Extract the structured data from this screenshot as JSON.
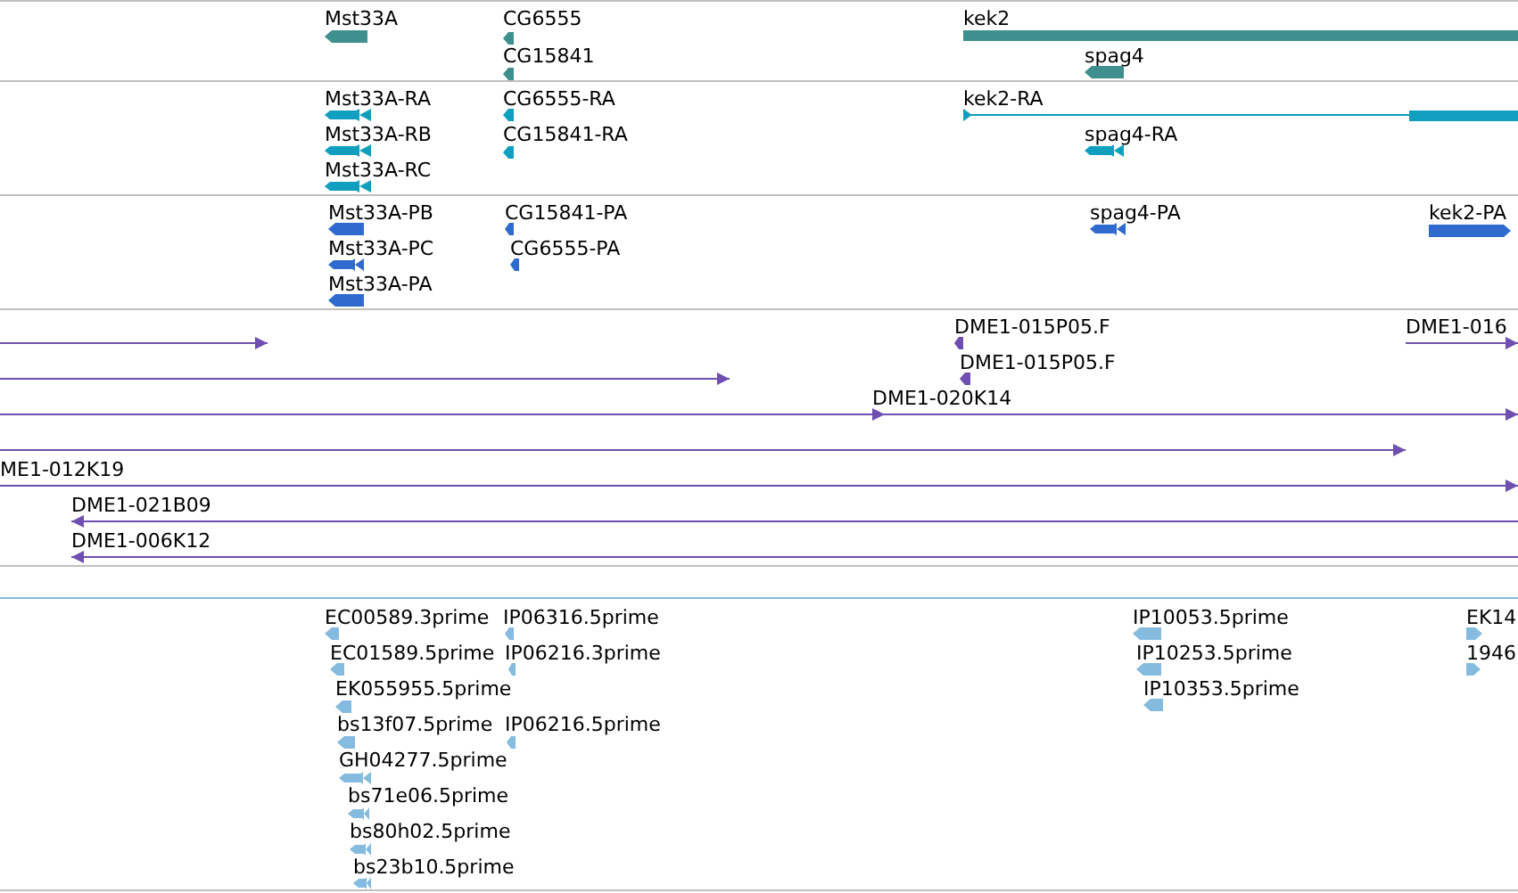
{
  "tracks": [
    {
      "color": "#3f8f8f",
      "selected": false,
      "features": [
        {
          "label": "Mst33A",
          "kind": "block",
          "reverse": true
        },
        {
          "label": "CG6555",
          "kind": "block",
          "reverse": true
        },
        {
          "label": "CG15841",
          "kind": "block",
          "reverse": true
        },
        {
          "label": "kek2",
          "kind": "bar"
        },
        {
          "label": "spag4",
          "kind": "block",
          "reverse": true
        }
      ]
    },
    {
      "color": "#109fbf",
      "selected": false,
      "features": [
        {
          "label": "Mst33A-RA",
          "kind": "exons",
          "reverse": true
        },
        {
          "label": "Mst33A-RB",
          "kind": "exons",
          "reverse": true
        },
        {
          "label": "Mst33A-RC",
          "kind": "exons",
          "reverse": true
        },
        {
          "label": "CG6555-RA",
          "kind": "block",
          "reverse": true
        },
        {
          "label": "CG15841-RA",
          "kind": "block",
          "reverse": true
        },
        {
          "label": "kek2-RA",
          "kind": "transcript",
          "reverse": false
        },
        {
          "label": "spag4-RA",
          "kind": "exons",
          "reverse": true
        }
      ]
    },
    {
      "color": "#2f6bcf",
      "selected": false,
      "features": [
        {
          "label": "Mst33A-PB",
          "kind": "block",
          "reverse": true
        },
        {
          "label": "Mst33A-PC",
          "kind": "exons",
          "reverse": true
        },
        {
          "label": "Mst33A-PA",
          "kind": "block",
          "reverse": true
        },
        {
          "label": "CG15841-PA",
          "kind": "block",
          "reverse": true
        },
        {
          "label": "CG6555-PA",
          "kind": "block",
          "reverse": true
        },
        {
          "label": "spag4-PA",
          "kind": "exons",
          "reverse": true
        },
        {
          "label": "kek2-PA",
          "kind": "block",
          "reverse": false
        }
      ]
    },
    {
      "color": "#6f4fb0",
      "selected": false,
      "features": [
        {
          "kind": "line",
          "reverse": false
        },
        {
          "label": "DME1-015P05.F",
          "kind": "block",
          "reverse": true
        },
        {
          "label": "DME1-016",
          "kind": "line",
          "reverse": false
        },
        {
          "kind": "line",
          "reverse": false
        },
        {
          "label": "DME1-015P05.F",
          "kind": "block",
          "reverse": true
        },
        {
          "kind": "line",
          "reverse": false
        },
        {
          "label": "DME1-020K14",
          "kind": "line",
          "reverse": false
        },
        {
          "kind": "line",
          "reverse": false
        },
        {
          "label": "ME1-012K19",
          "kind": "line",
          "reverse": false
        },
        {
          "label": "DME1-021B09",
          "kind": "line",
          "reverse": true
        },
        {
          "label": "DME1-006K12",
          "kind": "line",
          "reverse": true
        }
      ]
    },
    {
      "color": "#85bbdf",
      "selected": true,
      "features": [
        {
          "label": "EC00589.3prime",
          "kind": "block",
          "reverse": true
        },
        {
          "label": "EC01589.5prime",
          "kind": "block",
          "reverse": true
        },
        {
          "label": "EK055955.5prime",
          "kind": "block",
          "reverse": true
        },
        {
          "label": "bs13f07.5prime",
          "kind": "block",
          "reverse": true
        },
        {
          "label": "GH04277.5prime",
          "kind": "exons",
          "reverse": true
        },
        {
          "label": "bs71e06.5prime",
          "kind": "exons",
          "reverse": true
        },
        {
          "label": "bs80h02.5prime",
          "kind": "exons",
          "reverse": true
        },
        {
          "label": "bs23b10.5prime",
          "kind": "exons",
          "reverse": true
        },
        {
          "label": "IP06316.5prime",
          "kind": "block",
          "reverse": true
        },
        {
          "label": "IP06216.3prime",
          "kind": "block",
          "reverse": true
        },
        {
          "label": "IP06216.5prime",
          "kind": "block",
          "reverse": true
        },
        {
          "label": "IP10053.5prime",
          "kind": "block",
          "reverse": true
        },
        {
          "label": "IP10253.5prime",
          "kind": "block",
          "reverse": true
        },
        {
          "label": "IP10353.5prime",
          "kind": "block",
          "reverse": true
        },
        {
          "label": "EK14",
          "kind": "block",
          "reverse": false
        },
        {
          "label": "1946",
          "kind": "block",
          "reverse": false
        }
      ]
    }
  ]
}
